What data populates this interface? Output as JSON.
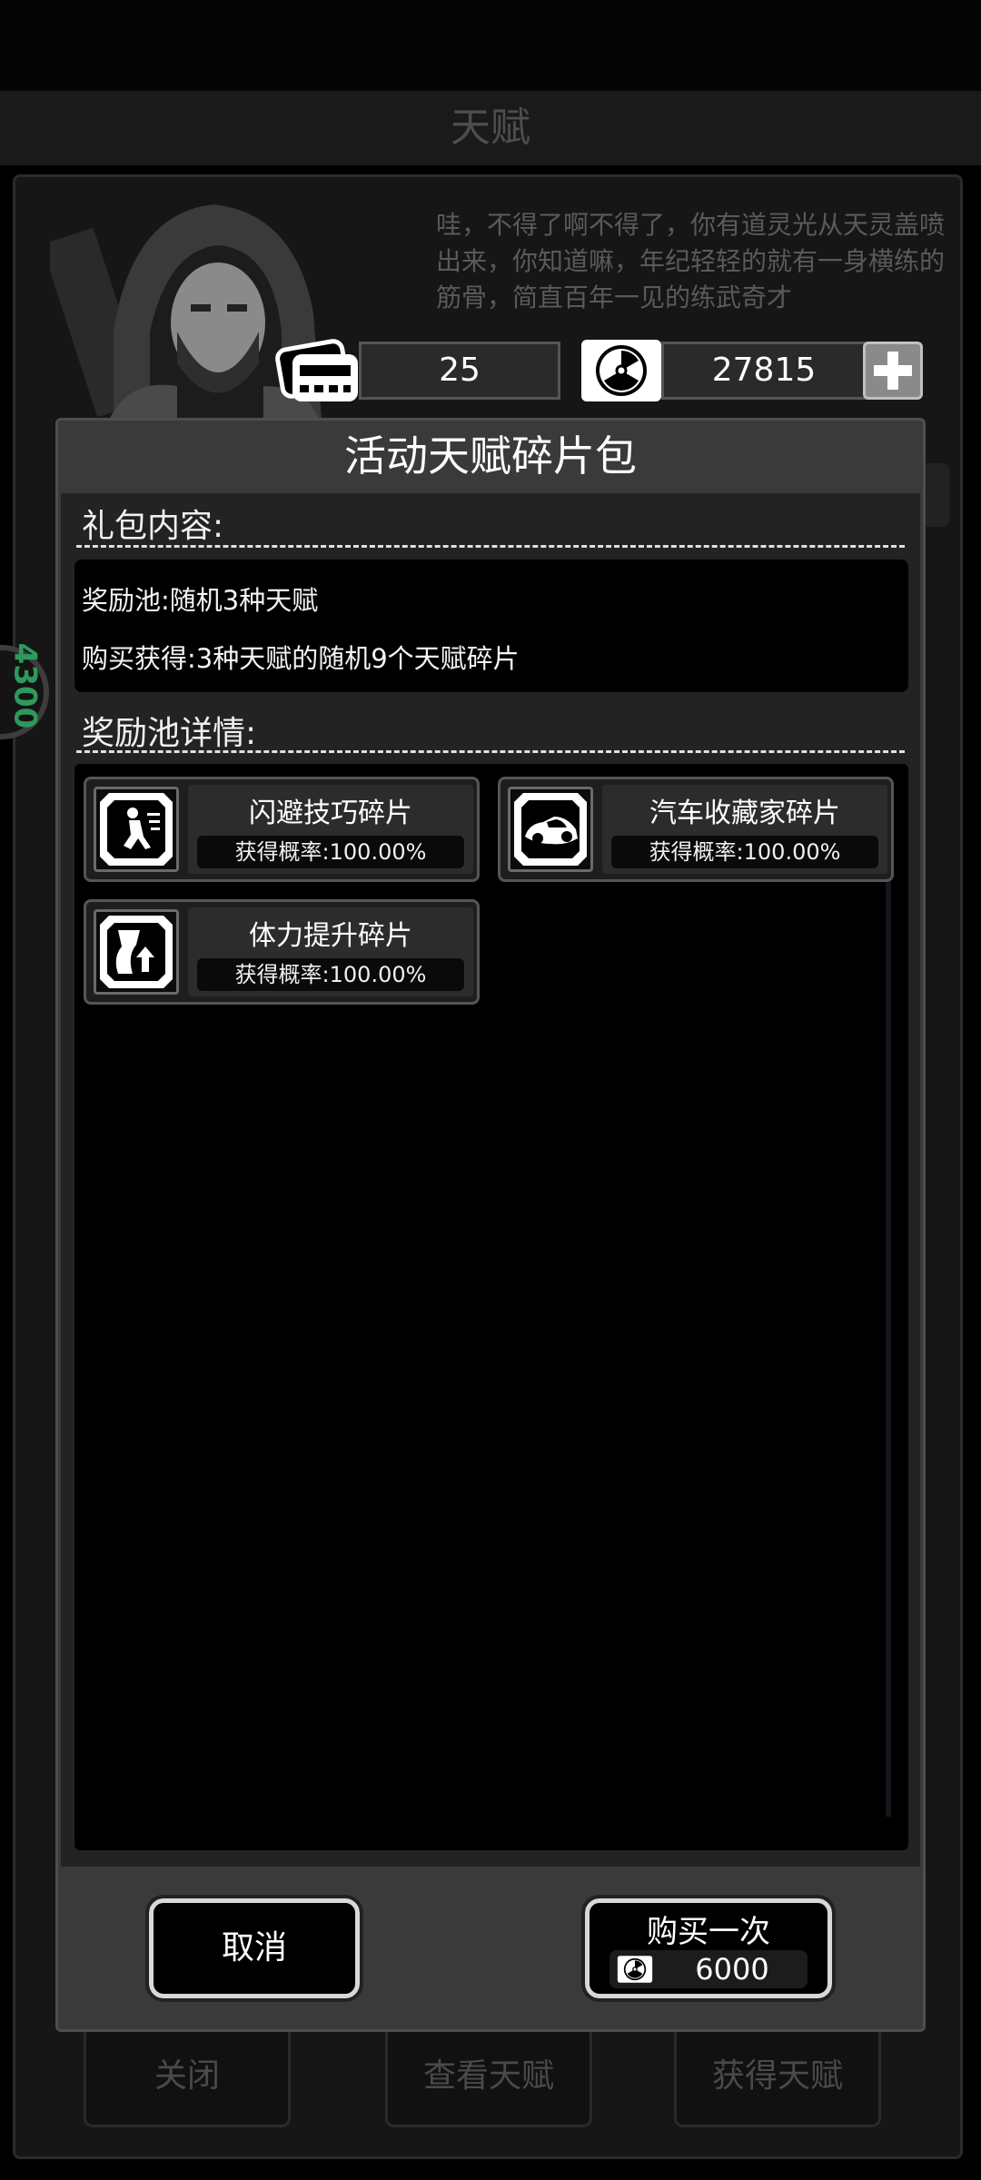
{
  "background": {
    "title": "天赋",
    "speech_text": "哇，不得了啊不得了，你有道灵光从天灵盖喷出来，你知道嘛，年纪轻轻的就有一身横练的筋骨，简直百年一见的练武奇才",
    "badge_text": "4300",
    "bottom_buttons": [
      "关闭",
      "查看天赋",
      "获得天赋"
    ]
  },
  "currency": {
    "cards_count": "25",
    "radiation_count": "27815",
    "card_icon": "ticket-card-icon",
    "radiation_icon": "radiation-icon",
    "plus_icon": "plus-icon"
  },
  "popup": {
    "title": "活动天赋碎片包",
    "contents_label": "礼包内容:",
    "contents_lines": [
      "奖励池:随机3种天赋",
      "购买获得:3种天赋的随机9个天赋碎片"
    ],
    "pool_label": "奖励池详情:",
    "rewards": [
      {
        "name": "闪避技巧碎片",
        "prob": "获得概率:100.00%",
        "icon": "dodge-icon"
      },
      {
        "name": "汽车收藏家碎片",
        "prob": "获得概率:100.00%",
        "icon": "car-icon"
      },
      {
        "name": "体力提升碎片",
        "prob": "获得概率:100.00%",
        "icon": "stamina-up-icon"
      }
    ],
    "cancel_label": "取消",
    "buy_label": "购买一次",
    "buy_price": "6000"
  }
}
